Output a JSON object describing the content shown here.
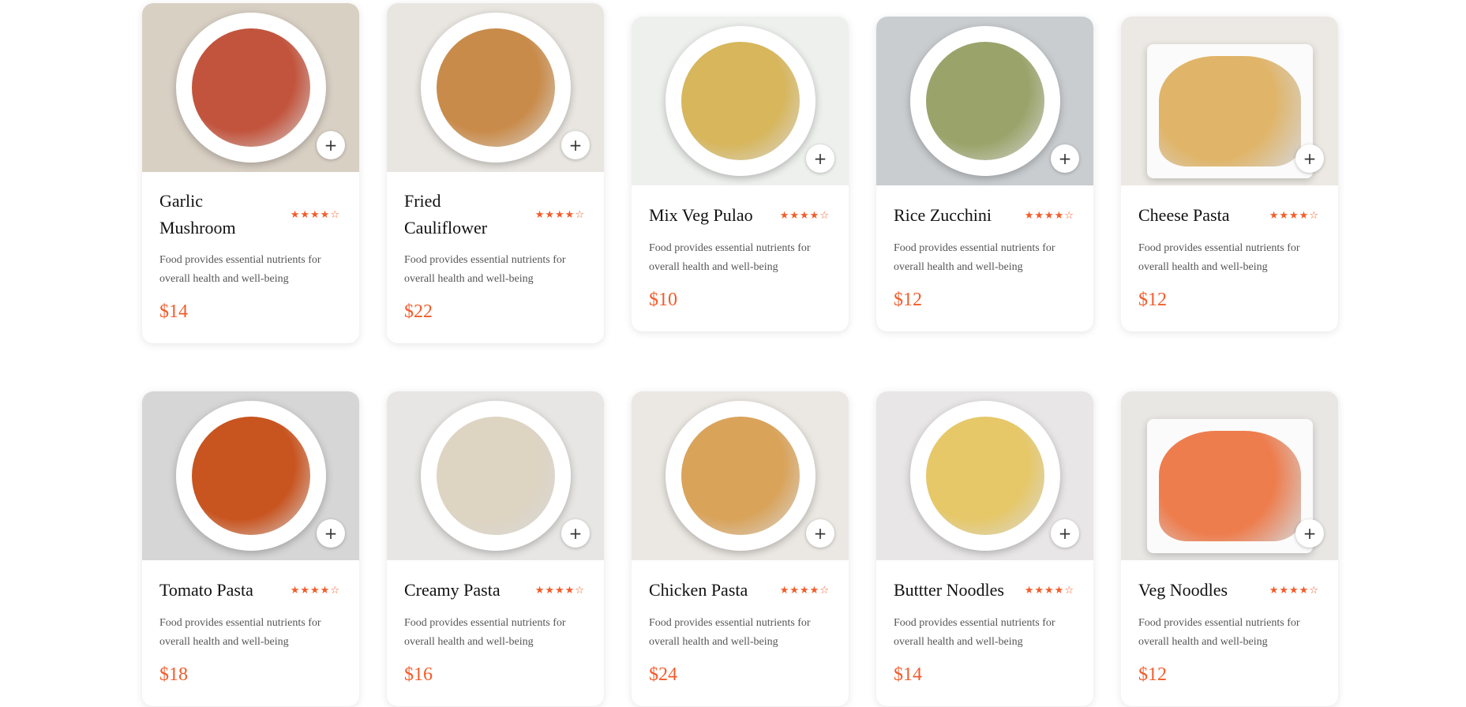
{
  "colors": {
    "accent": "#f25c2a",
    "card_bg": "#ffffff",
    "text": "#111111",
    "muted": "#555555"
  },
  "cards": [
    {
      "name": "Garlic Mushroom",
      "rating": 4,
      "description": "Food provides essential nutrients for overall health and well-being",
      "price": "$14",
      "add": "+",
      "img_bg": "#d9d0c4",
      "food_color": "#c2543d"
    },
    {
      "name": "Fried Cauliflower",
      "rating": 4,
      "description": "Food provides essential nutrients for overall health and well-being",
      "price": "$22",
      "add": "+",
      "img_bg": "#e9e6e1",
      "food_color": "#c98b4a"
    },
    {
      "name": "Mix Veg Pulao",
      "rating": 4,
      "description": "Food provides essential nutrients for overall health and well-being",
      "price": "$10",
      "add": "+",
      "img_bg": "#eef0ee",
      "food_color": "#d7b65c"
    },
    {
      "name": "Rice Zucchini",
      "rating": 4,
      "description": "Food provides essential nutrients for overall health and well-being",
      "price": "$12",
      "add": "+",
      "img_bg": "#c9cdd0",
      "food_color": "#9aa36a"
    },
    {
      "name": "Cheese Pasta",
      "rating": 4,
      "description": "Food provides essential nutrients for overall health and well-being",
      "price": "$12",
      "add": "+",
      "img_bg": "#ece8e3",
      "food_color": "#e0b56a"
    },
    {
      "name": "Tomato Pasta",
      "rating": 4,
      "description": "Food provides essential nutrients for overall health and well-being",
      "price": "$18",
      "add": "+",
      "img_bg": "#d6d6d6",
      "food_color": "#c8541f"
    },
    {
      "name": "Creamy Pasta",
      "rating": 4,
      "description": "Food provides essential nutrients for overall health and well-being",
      "price": "$16",
      "add": "+",
      "img_bg": "#e7e6e4",
      "food_color": "#ddd4c2"
    },
    {
      "name": "Chicken Pasta",
      "rating": 4,
      "description": "Food provides essential nutrients for overall health and well-being",
      "price": "$24",
      "add": "+",
      "img_bg": "#ebe7e2",
      "food_color": "#d9a35a"
    },
    {
      "name": "Buttter Noodles",
      "rating": 4,
      "description": "Food provides essential nutrients for overall health and well-being",
      "price": "$14",
      "add": "+",
      "img_bg": "#e8e6e6",
      "food_color": "#e6c869"
    },
    {
      "name": "Veg Noodles",
      "rating": 4,
      "description": "Food provides essential nutrients for overall health and well-being",
      "price": "$12",
      "add": "+",
      "img_bg": "#e9e7e4",
      "food_color": "#ee7d4e"
    }
  ]
}
